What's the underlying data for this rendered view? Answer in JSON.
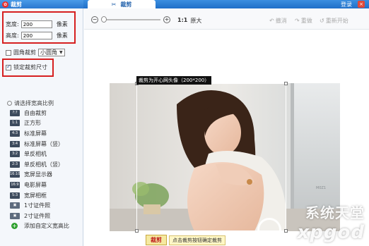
{
  "titlebar": {
    "app_title": "裁剪",
    "tab_label": "裁剪",
    "login": "登录",
    "close": "×"
  },
  "left_panel": {
    "width_label": "宽度:",
    "width_value": "200",
    "width_unit": "像素",
    "height_label": "高度:",
    "height_value": "200",
    "height_unit": "像素",
    "round_crop_label": "圆角裁剪",
    "round_select_value": "小圆角",
    "lock_size_label": "锁定裁剪尺寸",
    "ratio_title": "请选择宽高比例",
    "ratios": [
      {
        "icon": "?:?",
        "label": "自由裁剪"
      },
      {
        "icon": "1:1",
        "label": "正方形"
      },
      {
        "icon": "4:3",
        "label": "标准屏幕"
      },
      {
        "icon": "3:4",
        "label": "标准屏幕（竖）"
      },
      {
        "icon": "3:2",
        "label": "单反相机"
      },
      {
        "icon": "2:3",
        "label": "单反相机（竖）"
      },
      {
        "icon": "16:10",
        "label": "宽屏显示器"
      },
      {
        "icon": "16:9",
        "label": "电影屏幕"
      },
      {
        "icon": "5:3",
        "label": "宽屏相框"
      },
      {
        "icon": "",
        "label": "1寸证件照"
      },
      {
        "icon": "",
        "label": "2寸证件照"
      },
      {
        "icon": "+",
        "label": "添加自定义宽高比"
      }
    ]
  },
  "toolbar": {
    "zoom_ratio": "1:1",
    "zoom_text": "原大",
    "undo": "撤消",
    "redo": "重做",
    "restart": "重新开始"
  },
  "canvas": {
    "crop_tooltip": "裁剪为开心网头像（200*200）",
    "crop_button": "裁剪",
    "crop_hint": "点击裁剪按钮确定裁剪",
    "watermark_top": "系统天堂",
    "watermark_bottom": "xpgod",
    "photo_mark": "M0Z1"
  },
  "colors": {
    "accent": "#1f6fc8",
    "highlight_box": "#d62020"
  }
}
